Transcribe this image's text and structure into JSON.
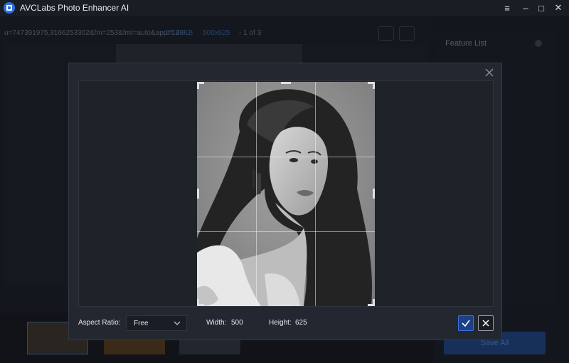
{
  "app": {
    "title": "AVCLabs Photo Enhancer AI"
  },
  "window_controls": {
    "menu": "≡",
    "minimize": "–",
    "maximize": "□",
    "close": "✕"
  },
  "background": {
    "filename": "u=747391975,3166253302&fm=253&fmt=auto&app=120...",
    "file_size": "27.48KB",
    "dimensions": "500x625",
    "count": "- 1 of 3",
    "feature_list": "Feature List",
    "save_all": "Save All"
  },
  "crop_dialog": {
    "aspect_ratio_label": "Aspect Ratio:",
    "aspect_ratio_value": "Free",
    "width_label": "Width:",
    "width_value": "500",
    "height_label": "Height:",
    "height_value": "625"
  },
  "icons": {
    "close": "close-icon",
    "confirm": "check-icon",
    "cancel": "x-icon",
    "chevron": "chevron-down-icon"
  }
}
